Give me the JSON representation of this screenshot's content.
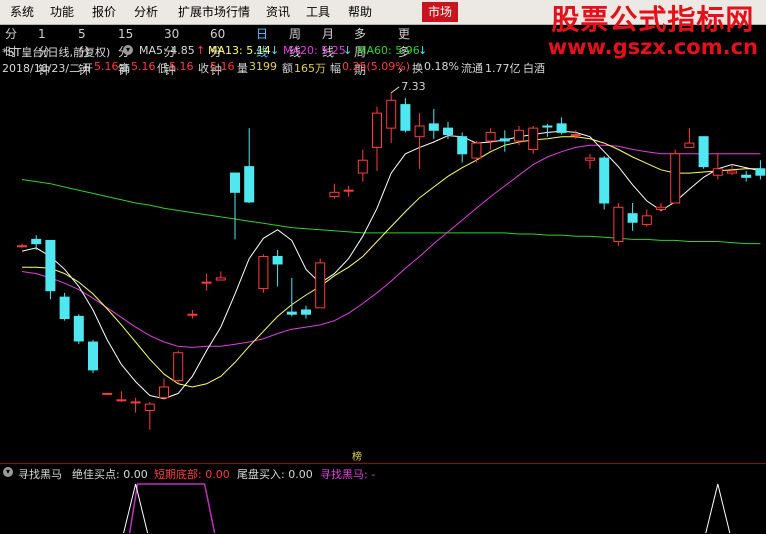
{
  "menubar": {
    "items": [
      "系统",
      "功能",
      "报价",
      "分析",
      "扩展市场行情",
      "资讯",
      "工具",
      "帮助"
    ],
    "market_tab": "市场"
  },
  "watermark": {
    "title": "股票公式指标网",
    "url": "www.gszx.com.cn"
  },
  "periods": {
    "tabs": [
      "分时",
      "1分钟",
      "5分钟",
      "15分钟",
      "30分钟",
      "60分钟",
      "日线",
      "周线",
      "月线",
      "多周期",
      "更多"
    ],
    "active": "日线"
  },
  "info": {
    "stock": "*ST皇台(日线,前复权)",
    "ma5": "MA5: 4.85",
    "ma13": "MA13: 5.14",
    "ma20": "MA20: 5.25",
    "ma60": "MA60: 5.96",
    "date": "2018/10/23/二",
    "open_label": "开",
    "open": "5.16",
    "high_label": "高",
    "high": "5.16",
    "low_label": "低",
    "low": "5.16",
    "close_label": "收",
    "close": "5.16",
    "vol_label": "量",
    "vol": "3199",
    "amt_label": "额",
    "amt": "165万",
    "chg_label": "幅",
    "chg": "0.25(5.09%)",
    "turn_label": "换",
    "turn": "0.18%",
    "float_label": "流通",
    "float": "1.77亿",
    "name": "白酒"
  },
  "colors": {
    "up": "#ff3b3b",
    "down": "#4fe8f0",
    "ma5": "#ffffff",
    "ma13": "#ffff66",
    "ma20": "#e040e0",
    "ma60": "#2fcf2f",
    "buy_signal": "#ffffff",
    "stage": "#c030c0"
  },
  "indicator": {
    "name": "寻找黑马",
    "jiajia": "绝佳买点: 0.00",
    "duanqi": "短期底部: 0.00",
    "weipan": "尾盘买入: 0.00",
    "xzhm": "寻找黑马: -"
  },
  "bang_label": "榜",
  "chart_data": {
    "type": "candlestick",
    "high_annotation": "7.33",
    "note": "Daily candlesticks of *ST皇台, price scale not printed; values estimated relative to the annotated high 7.33 and MA values.",
    "candles": [
      {
        "o": 5.9,
        "h": 5.92,
        "l": 5.88,
        "c": 5.9
      },
      {
        "o": 5.96,
        "h": 6.0,
        "l": 5.86,
        "c": 5.92
      },
      {
        "o": 5.95,
        "h": 5.95,
        "l": 5.4,
        "c": 5.48
      },
      {
        "o": 5.42,
        "h": 5.46,
        "l": 5.2,
        "c": 5.22
      },
      {
        "o": 5.24,
        "h": 5.26,
        "l": 4.98,
        "c": 5.01
      },
      {
        "o": 5.0,
        "h": 5.02,
        "l": 4.71,
        "c": 4.74
      },
      {
        "o": 4.52,
        "h": 4.52,
        "l": 4.52,
        "c": 4.52
      },
      {
        "o": 4.46,
        "h": 4.54,
        "l": 4.44,
        "c": 4.46
      },
      {
        "o": 4.44,
        "h": 4.48,
        "l": 4.34,
        "c": 4.44
      },
      {
        "o": 4.36,
        "h": 4.44,
        "l": 4.18,
        "c": 4.42
      },
      {
        "o": 4.48,
        "h": 4.66,
        "l": 4.46,
        "c": 4.58
      },
      {
        "o": 4.64,
        "h": 4.92,
        "l": 4.62,
        "c": 4.9
      },
      {
        "o": 5.26,
        "h": 5.3,
        "l": 5.22,
        "c": 5.26
      },
      {
        "o": 5.56,
        "h": 5.64,
        "l": 5.48,
        "c": 5.56
      },
      {
        "o": 5.58,
        "h": 5.66,
        "l": 5.58,
        "c": 5.6
      },
      {
        "o": 6.58,
        "h": 6.58,
        "l": 5.96,
        "c": 6.4
      },
      {
        "o": 6.64,
        "h": 7.0,
        "l": 6.3,
        "c": 6.31
      },
      {
        "o": 5.5,
        "h": 5.82,
        "l": 5.46,
        "c": 5.8
      },
      {
        "o": 5.8,
        "h": 5.86,
        "l": 5.52,
        "c": 5.73
      },
      {
        "o": 5.28,
        "h": 5.6,
        "l": 5.24,
        "c": 5.26
      },
      {
        "o": 5.3,
        "h": 5.34,
        "l": 5.22,
        "c": 5.26
      },
      {
        "o": 5.32,
        "h": 5.78,
        "l": 5.32,
        "c": 5.74
      },
      {
        "o": 6.36,
        "h": 6.48,
        "l": 6.34,
        "c": 6.4
      },
      {
        "o": 6.42,
        "h": 6.46,
        "l": 6.36,
        "c": 6.42
      },
      {
        "o": 6.58,
        "h": 6.8,
        "l": 6.5,
        "c": 6.7
      },
      {
        "o": 6.82,
        "h": 7.2,
        "l": 6.6,
        "c": 7.14
      },
      {
        "o": 7.0,
        "h": 7.33,
        "l": 6.86,
        "c": 7.26
      },
      {
        "o": 7.22,
        "h": 7.28,
        "l": 6.96,
        "c": 6.98
      },
      {
        "o": 6.92,
        "h": 7.14,
        "l": 6.62,
        "c": 7.02
      },
      {
        "o": 7.04,
        "h": 7.18,
        "l": 6.9,
        "c": 6.98
      },
      {
        "o": 7.0,
        "h": 7.06,
        "l": 6.9,
        "c": 6.94
      },
      {
        "o": 6.92,
        "h": 6.96,
        "l": 6.68,
        "c": 6.76
      },
      {
        "o": 6.72,
        "h": 6.88,
        "l": 6.68,
        "c": 6.86
      },
      {
        "o": 6.88,
        "h": 7.0,
        "l": 6.8,
        "c": 6.96
      },
      {
        "o": 6.9,
        "h": 6.98,
        "l": 6.78,
        "c": 6.88
      },
      {
        "o": 6.88,
        "h": 7.02,
        "l": 6.84,
        "c": 6.98
      },
      {
        "o": 6.8,
        "h": 7.02,
        "l": 6.76,
        "c": 7.0
      },
      {
        "o": 7.02,
        "h": 7.04,
        "l": 6.92,
        "c": 7.01
      },
      {
        "o": 7.04,
        "h": 7.1,
        "l": 6.94,
        "c": 6.96
      },
      {
        "o": 6.94,
        "h": 6.98,
        "l": 6.9,
        "c": 6.94
      },
      {
        "o": 6.7,
        "h": 6.76,
        "l": 6.62,
        "c": 6.72
      },
      {
        "o": 6.72,
        "h": 6.74,
        "l": 6.24,
        "c": 6.3
      },
      {
        "o": 5.94,
        "h": 6.3,
        "l": 5.9,
        "c": 6.26
      },
      {
        "o": 6.2,
        "h": 6.3,
        "l": 6.04,
        "c": 6.12
      },
      {
        "o": 6.1,
        "h": 6.24,
        "l": 6.08,
        "c": 6.18
      },
      {
        "o": 6.24,
        "h": 6.3,
        "l": 6.22,
        "c": 6.26
      },
      {
        "o": 6.3,
        "h": 6.8,
        "l": 6.3,
        "c": 6.76
      },
      {
        "o": 6.82,
        "h": 7.0,
        "l": 6.84,
        "c": 6.86
      },
      {
        "o": 6.92,
        "h": 6.92,
        "l": 6.62,
        "c": 6.64
      },
      {
        "o": 6.56,
        "h": 6.76,
        "l": 6.52,
        "c": 6.62
      },
      {
        "o": 6.58,
        "h": 6.66,
        "l": 6.56,
        "c": 6.6
      },
      {
        "o": 6.56,
        "h": 6.6,
        "l": 6.5,
        "c": 6.54
      },
      {
        "o": 6.62,
        "h": 6.7,
        "l": 6.52,
        "c": 6.56
      }
    ],
    "ma5": [
      5.85,
      5.88,
      5.8,
      5.68,
      5.52,
      5.3,
      5.02,
      4.79,
      4.63,
      4.5,
      4.47,
      4.52,
      4.68,
      4.92,
      5.14,
      5.45,
      5.78,
      5.97,
      6.05,
      5.95,
      5.68,
      5.55,
      5.64,
      5.78,
      5.99,
      6.25,
      6.58,
      6.76,
      6.82,
      6.87,
      6.93,
      6.92,
      6.86,
      6.87,
      6.89,
      6.92,
      6.94,
      6.96,
      6.97,
      6.96,
      6.92,
      6.78,
      6.64,
      6.47,
      6.32,
      6.23,
      6.31,
      6.43,
      6.54,
      6.62,
      6.66,
      6.63,
      6.6
    ],
    "ma13": [
      5.7,
      5.7,
      5.69,
      5.64,
      5.56,
      5.45,
      5.31,
      5.16,
      5.0,
      4.84,
      4.7,
      4.61,
      4.58,
      4.61,
      4.68,
      4.81,
      4.96,
      5.1,
      5.24,
      5.35,
      5.44,
      5.52,
      5.62,
      5.7,
      5.8,
      5.94,
      6.08,
      6.22,
      6.35,
      6.45,
      6.55,
      6.63,
      6.7,
      6.78,
      6.84,
      6.87,
      6.89,
      6.9,
      6.92,
      6.92,
      6.9,
      6.86,
      6.8,
      6.73,
      6.67,
      6.61,
      6.58,
      6.58,
      6.59,
      6.6,
      6.61,
      6.62,
      6.62
    ],
    "ma20": [
      5.66,
      5.64,
      5.6,
      5.55,
      5.49,
      5.41,
      5.32,
      5.23,
      5.14,
      5.06,
      5.0,
      4.96,
      4.95,
      4.96,
      4.96,
      4.98,
      5.0,
      5.03,
      5.08,
      5.12,
      5.14,
      5.16,
      5.2,
      5.27,
      5.36,
      5.46,
      5.57,
      5.69,
      5.8,
      5.92,
      6.03,
      6.14,
      6.25,
      6.36,
      6.46,
      6.56,
      6.66,
      6.73,
      6.78,
      6.82,
      6.84,
      6.84,
      6.83,
      6.8,
      6.78,
      6.76,
      6.76,
      6.76,
      6.76,
      6.76,
      6.76,
      6.76,
      6.76
    ],
    "ma60": [
      6.52,
      6.5,
      6.48,
      6.45,
      6.42,
      6.39,
      6.36,
      6.33,
      6.3,
      6.28,
      6.25,
      6.23,
      6.21,
      6.19,
      6.17,
      6.15,
      6.13,
      6.11,
      6.09,
      6.07,
      6.06,
      6.05,
      6.04,
      6.03,
      6.02,
      6.02,
      6.02,
      6.02,
      6.02,
      6.02,
      6.02,
      6.02,
      6.02,
      6.02,
      6.02,
      6.01,
      6.01,
      6.0,
      6.0,
      5.99,
      5.99,
      5.98,
      5.97,
      5.96,
      5.96,
      5.95,
      5.95,
      5.94,
      5.94,
      5.94,
      5.93,
      5.92,
      5.92
    ],
    "indicator": {
      "buy_signal_pulses": [
        8,
        49
      ],
      "stage_range": [
        8,
        13
      ]
    }
  }
}
